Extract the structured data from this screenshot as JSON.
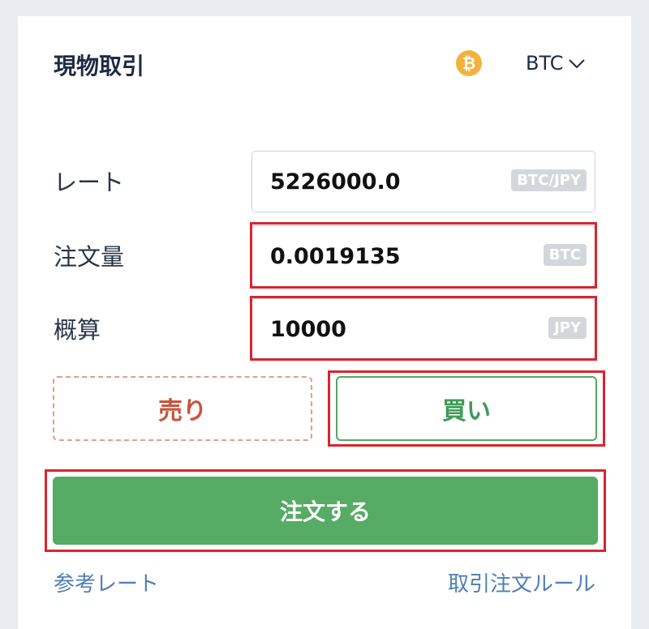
{
  "header": {
    "title": "現物取引",
    "coin_symbol": "₿",
    "currency_label": "BTC"
  },
  "rate": {
    "label": "レート",
    "value": "5226000.0",
    "unit": "BTC/JPY"
  },
  "amount": {
    "label": "注文量",
    "value": "0.0019135",
    "unit": "BTC"
  },
  "estimate": {
    "label": "概算",
    "value": "10000",
    "unit": "JPY"
  },
  "actions": {
    "sell_label": "売り",
    "buy_label": "買い",
    "order_label": "注文する"
  },
  "footer": {
    "reference_rate_link": "参考レート",
    "rules_link": "取引注文ルール"
  },
  "colors": {
    "accent_green": "#56ab65",
    "sell_red": "#c8553d",
    "highlight_red": "#d9252f",
    "coin_gold": "#f2b33d"
  }
}
